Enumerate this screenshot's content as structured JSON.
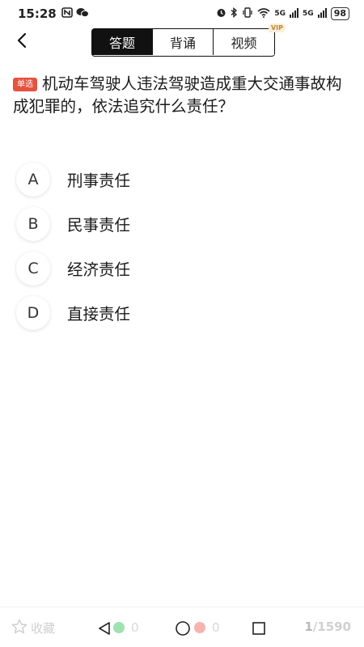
{
  "status_bar": {
    "time": "15:28",
    "left_icons": [
      "nfc-icon",
      "wechat-icon"
    ],
    "right_icons": [
      "alarm-icon",
      "bluetooth-icon",
      "vibrate-icon",
      "wifi-icon"
    ],
    "signal1": "5G",
    "signal2": "5G",
    "battery": "98"
  },
  "header": {
    "tabs": [
      {
        "label": "答题",
        "active": true
      },
      {
        "label": "背诵",
        "active": false
      },
      {
        "label": "视频",
        "active": false
      }
    ],
    "vip_badge": "VIP"
  },
  "question": {
    "tag": "单选",
    "text": "机动车驾驶人违法驾驶造成重大交通事故构成犯罪的，依法追究什么责任？"
  },
  "options": [
    {
      "letter": "A",
      "text": "刑事责任"
    },
    {
      "letter": "B",
      "text": "民事责任"
    },
    {
      "letter": "C",
      "text": "经济责任"
    },
    {
      "letter": "D",
      "text": "直接责任"
    }
  ],
  "bottom_bar": {
    "favorite_label": "收藏",
    "correct_count": "0",
    "wrong_count": "0",
    "progress_current": "1",
    "progress_total": "/1590"
  },
  "colors": {
    "accent": "#111111",
    "tag_red": "#e5533f",
    "vip_gold": "#b88a3a"
  }
}
